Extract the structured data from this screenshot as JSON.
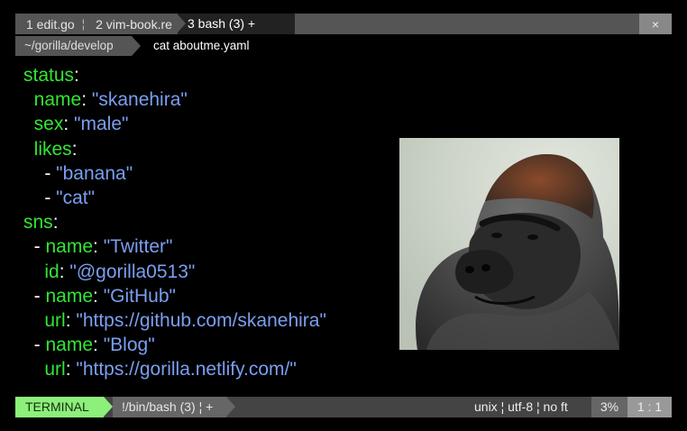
{
  "tabbar": {
    "tabs": [
      {
        "label": "1 edit.go"
      },
      {
        "label": "2 vim-book.re"
      }
    ],
    "active_tab": "3 bash (3) +",
    "separator": "¦",
    "close_label": "×"
  },
  "pathbar": {
    "path": "~/gorilla/develop",
    "command": "cat aboutme.yaml"
  },
  "yaml": {
    "l1": {
      "key": "status",
      "colon": ":"
    },
    "l2": {
      "key": "name",
      "colon": ": ",
      "val": "\"skanehira\""
    },
    "l3": {
      "key": "sex",
      "colon": ": ",
      "val": "\"male\""
    },
    "l4": {
      "key": "likes",
      "colon": ":"
    },
    "l5": {
      "dash": "- ",
      "val": "\"banana\""
    },
    "l6": {
      "dash": "- ",
      "val": "\"cat\""
    },
    "l7": {
      "key": "sns",
      "colon": ":"
    },
    "l8": {
      "dash": "- ",
      "key": "name",
      "colon": ": ",
      "val": "\"Twitter\""
    },
    "l9": {
      "key": "id",
      "colon": ": ",
      "val": "\"@gorilla0513\""
    },
    "l10": {
      "dash": "- ",
      "key": "name",
      "colon": ": ",
      "val": "\"GitHub\""
    },
    "l11": {
      "key": "url",
      "colon": ": ",
      "val": "\"https://github.com/skanehira\""
    },
    "l12": {
      "dash": "- ",
      "key": "name",
      "colon": ": ",
      "val": "\"Blog\""
    },
    "l13": {
      "key": "url",
      "colon": ": ",
      "val": "\"https://gorilla.netlify.com/\""
    }
  },
  "statusbar": {
    "mode": "TERMINAL",
    "shell": "!/bin/bash (3) ¦  +",
    "fileinfo": "unix ¦ utf-8 ¦ no  ft",
    "percent": "3%",
    "position": "1 : 1"
  },
  "colors": {
    "key": "#33e533",
    "string": "#7a9ff0",
    "mode_bg": "#8cf07a"
  }
}
